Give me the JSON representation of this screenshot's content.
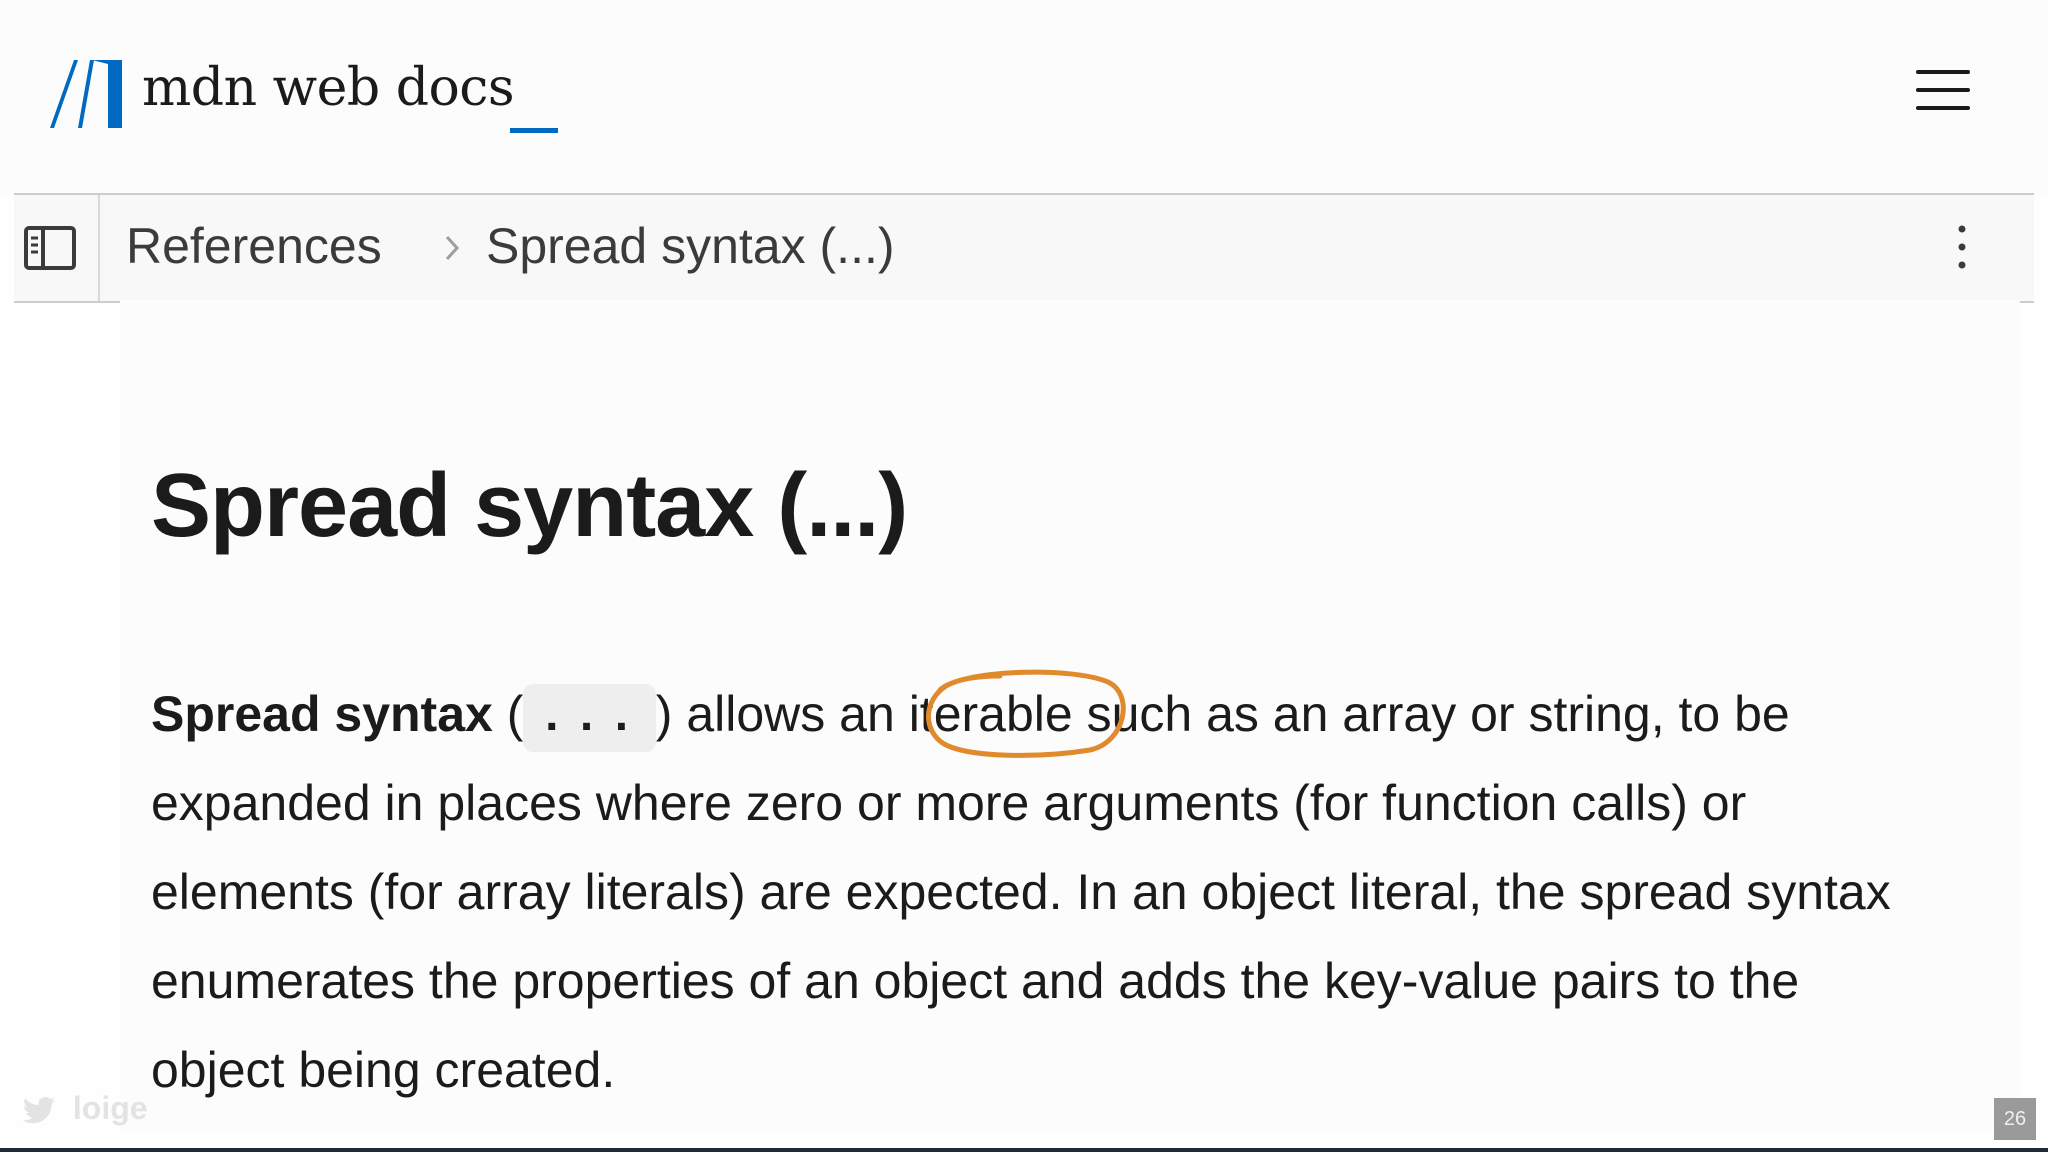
{
  "header": {
    "brand": "mdn web docs",
    "logo_icon": "mdn-logo-icon",
    "menu_icon": "hamburger-menu-icon",
    "accent_color": "#0069c2"
  },
  "breadcrumb": {
    "sidebar_toggle_icon": "sidebar-toggle-icon",
    "items": [
      "References",
      "Spread syntax (...)"
    ],
    "separator_icon": "chevron-right-icon",
    "more_icon": "kebab-menu-icon"
  },
  "article": {
    "title": "Spread syntax (...)",
    "intro": {
      "term": "Spread syntax",
      "open_paren": " (",
      "code": "...",
      "close_paren": ")",
      "text_1": " allows an ",
      "highlighted_word": "iterable",
      "text_2": " such as an array or string, to be expanded in places where zero or more arguments (for function calls) or elements (for array literals) are expected. In an object literal, the spread syntax enumerates the properties of an object and adds the key-value pairs to the object being created.",
      "annotation_color": "#e08a2c"
    }
  },
  "footer": {
    "twitter_handle": "loige",
    "twitter_icon": "twitter-bird-icon",
    "slide_number": "26"
  }
}
